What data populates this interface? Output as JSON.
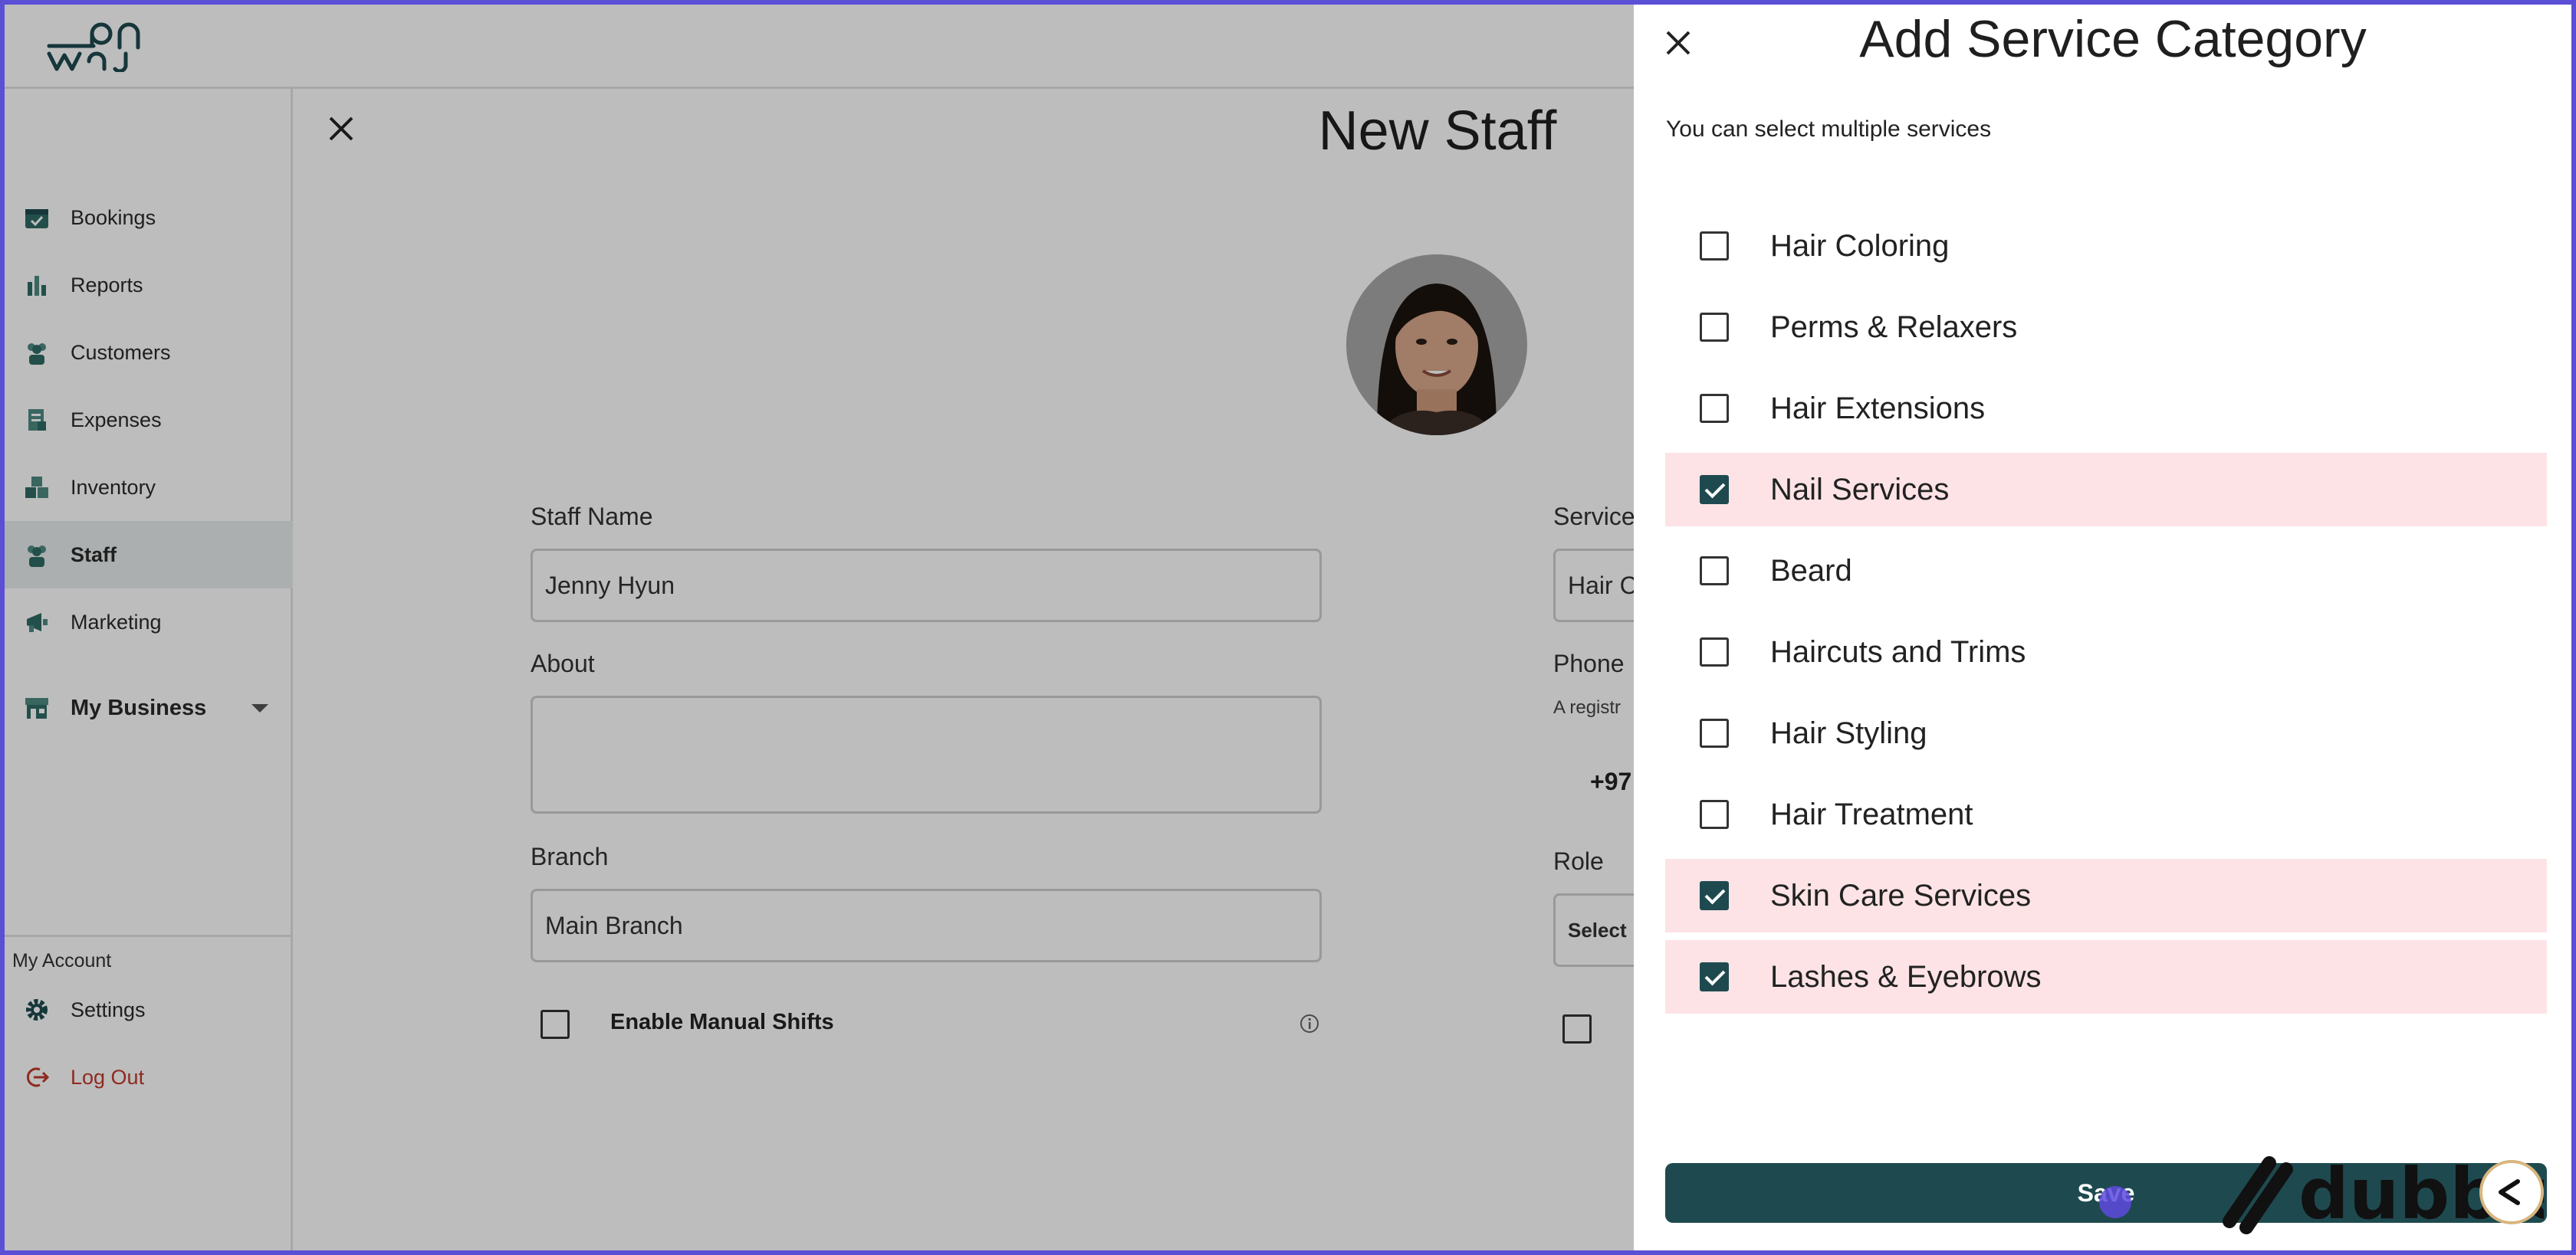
{
  "app": {
    "logo_text": "waj"
  },
  "sidebar": {
    "items": [
      {
        "label": "Bookings",
        "icon": "calendar-check-icon"
      },
      {
        "label": "Reports",
        "icon": "bar-chart-icon"
      },
      {
        "label": "Customers",
        "icon": "people-icon"
      },
      {
        "label": "Expenses",
        "icon": "receipt-icon"
      },
      {
        "label": "Inventory",
        "icon": "boxes-icon"
      },
      {
        "label": "Staff",
        "icon": "staff-icon",
        "active": true
      },
      {
        "label": "Marketing",
        "icon": "megaphone-icon"
      }
    ],
    "my_business": "My Business",
    "account_heading": "My Account",
    "settings": "Settings",
    "logout": "Log Out"
  },
  "form": {
    "title": "New Staff",
    "staff_name_label": "Staff Name",
    "staff_name_value": "Jenny Hyun",
    "about_label": "About",
    "about_value": "",
    "branch_label": "Branch",
    "branch_value": "Main Branch",
    "manual_shifts_label": "Enable Manual Shifts",
    "service_label": "Service",
    "service_value": "Hair C",
    "phone_label": "Phone",
    "phone_note": "A registr",
    "phone_prefix": "+97",
    "role_label": "Role",
    "role_value": "Select"
  },
  "drawer": {
    "title": "Add Service Category",
    "subtitle": "You can select multiple services",
    "options": [
      {
        "label": "Hair Coloring",
        "checked": false
      },
      {
        "label": "Perms & Relaxers",
        "checked": false
      },
      {
        "label": "Hair Extensions",
        "checked": false
      },
      {
        "label": "Nail Services",
        "checked": true
      },
      {
        "label": "Beard",
        "checked": false
      },
      {
        "label": "Haircuts and Trims",
        "checked": false
      },
      {
        "label": "Hair Styling",
        "checked": false
      },
      {
        "label": "Hair Treatment",
        "checked": false
      },
      {
        "label": "Skin Care Services",
        "checked": true
      },
      {
        "label": "Lashes & Eyebrows",
        "checked": true
      }
    ],
    "save_label": "Save"
  },
  "watermark": "dubble",
  "colors": {
    "brand": "#1e4a4f",
    "selected_row": "#fde3e6",
    "logout": "#c0392b",
    "frame": "#5b4fd6"
  }
}
